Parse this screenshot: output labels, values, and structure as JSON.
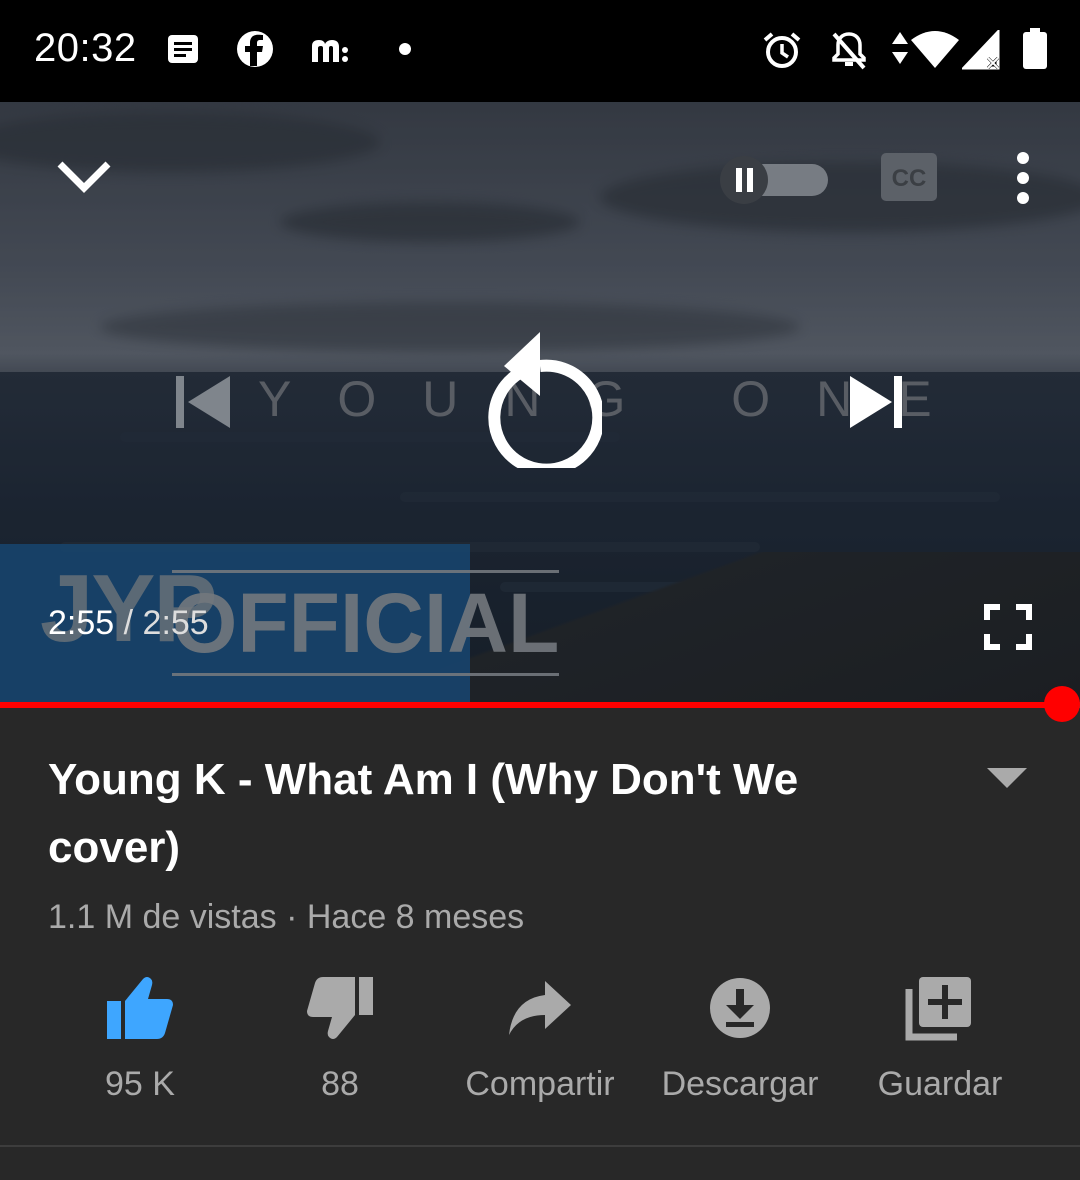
{
  "status_bar": {
    "time": "20:32"
  },
  "player": {
    "elapsed": "2:55",
    "separator": " / ",
    "duration": "2:55",
    "progress": 1.0,
    "watermark_wordmark": "YOUNG ONE",
    "watermark_logo": "JYP",
    "watermark_official": "OFFICIAL"
  },
  "video": {
    "title": "Young K - What Am I (Why Don't We cover)",
    "meta": "1.1 M de vistas · Hace 8 meses"
  },
  "actions": [
    {
      "label": "95 K",
      "icon": "thumbs-up-icon",
      "color": "#3ea6ff"
    },
    {
      "label": "88",
      "icon": "thumbs-down-icon",
      "color": "#aaaaaa"
    },
    {
      "label": "Compartir",
      "icon": "share-icon",
      "color": "#aaaaaa"
    },
    {
      "label": "Descargar",
      "icon": "download-icon",
      "color": "#aaaaaa"
    },
    {
      "label": "Guardar",
      "icon": "add-to-playlist-icon",
      "color": "#aaaaaa"
    }
  ],
  "colors": {
    "accent": "#ff0000",
    "like": "#3ea6ff",
    "background": "#282828"
  }
}
